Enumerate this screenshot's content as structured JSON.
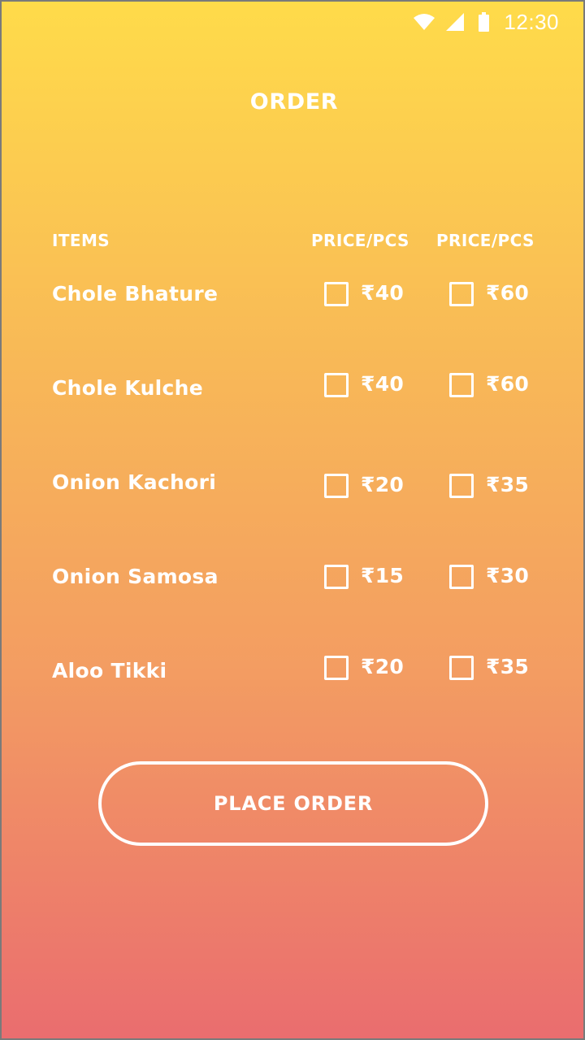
{
  "status_bar": {
    "time": "12:30",
    "icons": [
      "wifi-icon",
      "signal-icon",
      "battery-icon"
    ]
  },
  "title": "ORDER",
  "table": {
    "headers": {
      "items": "ITEMS",
      "price_1": "PRICE/PCS",
      "price_2": "PRICE/PCS"
    },
    "rows": [
      {
        "name": "Chole Bhature",
        "price_1": "₹40",
        "price_2": "₹60",
        "checked_1": false,
        "checked_2": false
      },
      {
        "name": "Chole Kulche",
        "price_1": "₹40",
        "price_2": "₹60",
        "checked_1": false,
        "checked_2": false
      },
      {
        "name": "Onion Kachori",
        "price_1": "₹20",
        "price_2": "₹35",
        "checked_1": false,
        "checked_2": false
      },
      {
        "name": "Onion Samosa",
        "price_1": "₹15",
        "price_2": "₹30",
        "checked_1": false,
        "checked_2": false
      },
      {
        "name": "Aloo Tikki",
        "price_1": "₹20",
        "price_2": "₹35",
        "checked_1": false,
        "checked_2": false
      }
    ]
  },
  "place_order_label": "PLACE ORDER",
  "colors": {
    "gradient_top": "#ffdb4a",
    "gradient_bottom": "#ea6d6f",
    "foreground": "#ffffff"
  }
}
